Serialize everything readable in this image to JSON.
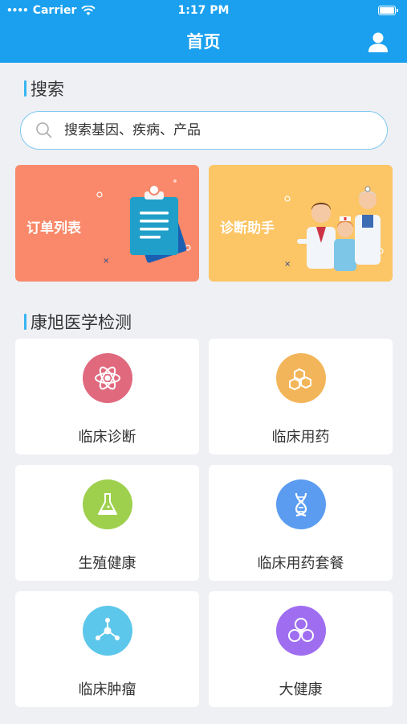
{
  "status_bar": {
    "carrier": "Carrier",
    "time": "1:17 PM"
  },
  "nav": {
    "title": "首页"
  },
  "search_section": {
    "title": "搜索",
    "placeholder": "搜索基因、疾病、产品"
  },
  "banners": [
    {
      "label": "订单列表",
      "color": "#f9896a"
    },
    {
      "label": "诊断助手",
      "color": "#fcc566"
    }
  ],
  "test_section": {
    "title": "康旭医学检测",
    "items": [
      {
        "label": "临床诊断",
        "icon": "atom-icon",
        "color": "#e0697e"
      },
      {
        "label": "临床用药",
        "icon": "molecule-icon",
        "color": "#f3b55a"
      },
      {
        "label": "生殖健康",
        "icon": "flask-icon",
        "color": "#9ed04e"
      },
      {
        "label": "临床用药套餐",
        "icon": "dna-icon",
        "color": "#5b9cf0"
      },
      {
        "label": "临床肿瘤",
        "icon": "cell-icon",
        "color": "#5cc7ea"
      },
      {
        "label": "大健康",
        "icon": "biohazard-icon",
        "color": "#9f6ef0"
      }
    ]
  }
}
